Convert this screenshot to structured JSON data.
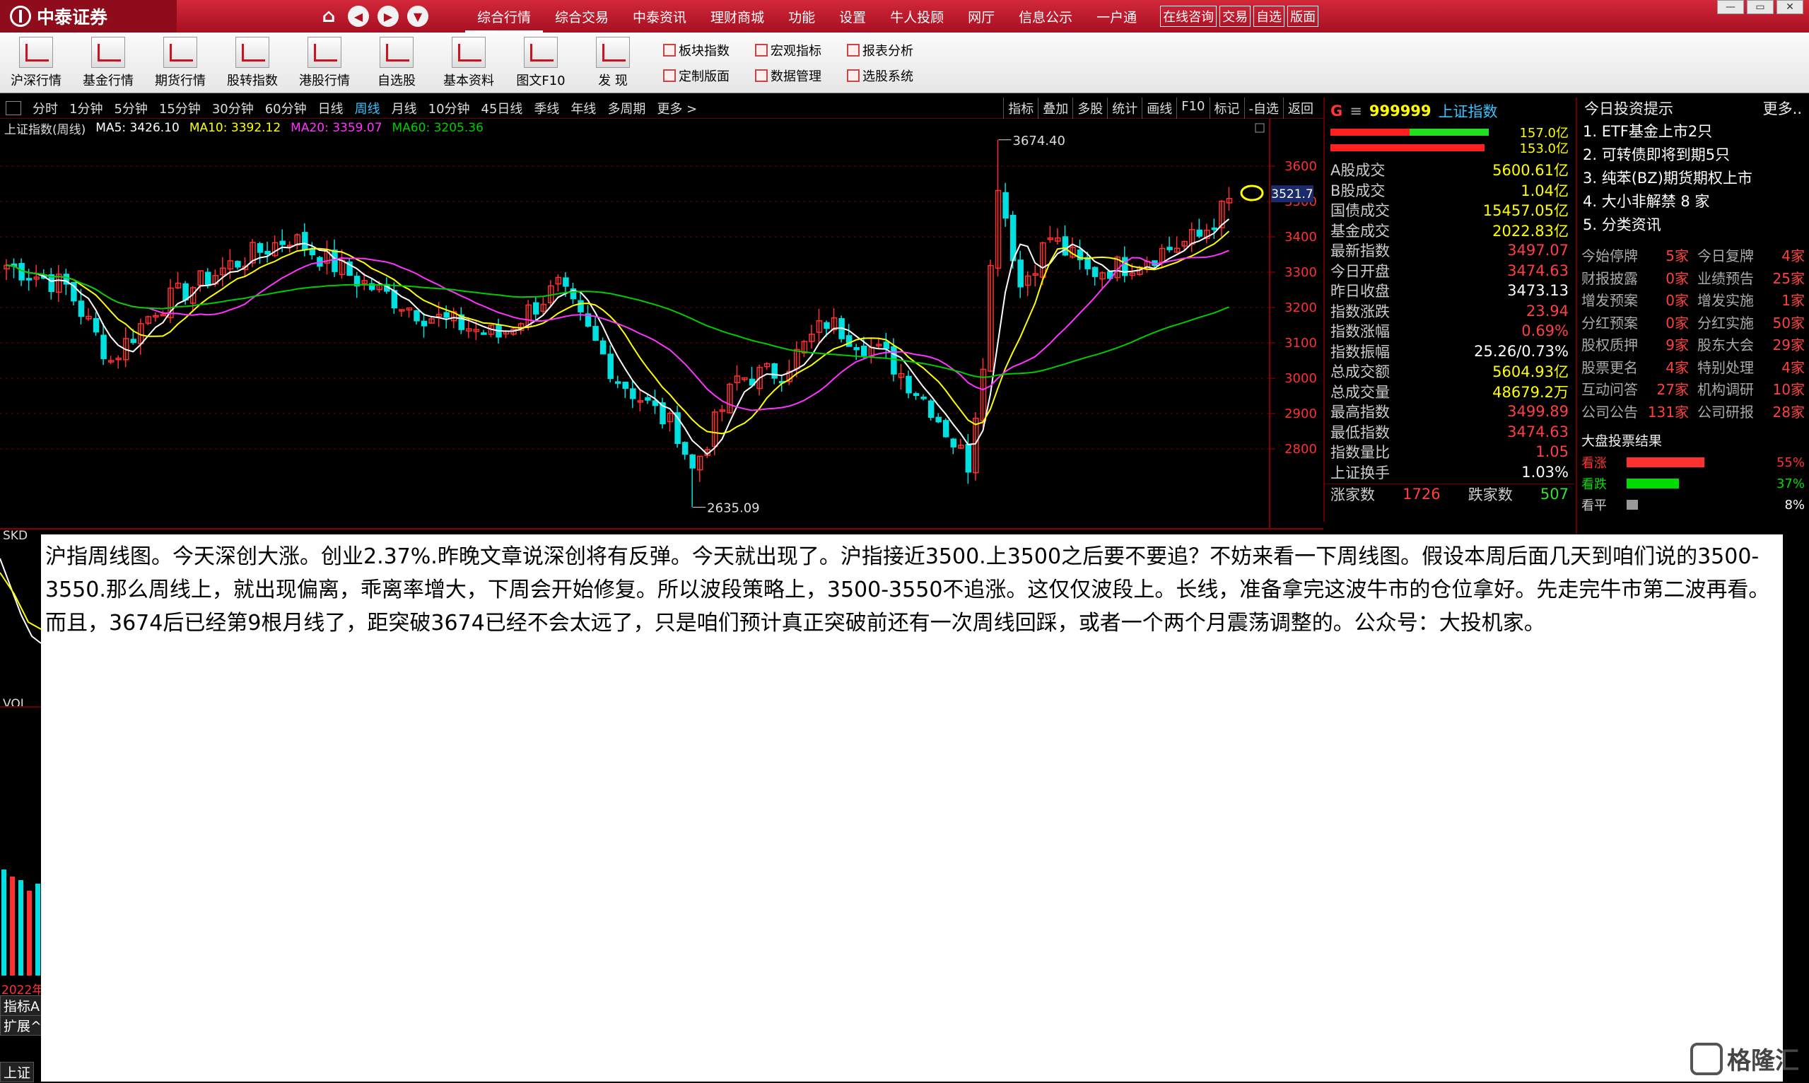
{
  "app": {
    "logo": "中泰证券",
    "menu": [
      "综合行情",
      "综合交易",
      "中泰资讯",
      "理财商城",
      "功能",
      "设置",
      "牛人投顾",
      "网厅",
      "信息公示",
      "一户通"
    ],
    "title_buttons": [
      "在线咨询",
      "交易",
      "自选",
      "版面"
    ]
  },
  "toolbar": {
    "tools": [
      "沪深行情",
      "基金行情",
      "期货行情",
      "股转指数",
      "港股行情",
      "自选股",
      "基本资料",
      "图文F10",
      "发  现"
    ],
    "small_tools": [
      "板块指数",
      "宏观指标",
      "报表分析",
      "定制版面",
      "数据管理",
      "选股系统"
    ]
  },
  "periods": [
    "分时",
    "1分钟",
    "5分钟",
    "15分钟",
    "30分钟",
    "60分钟",
    "日线",
    "周线",
    "月线",
    "10分钟",
    "45日线",
    "季线",
    "年线",
    "多周期",
    "更多 >"
  ],
  "active_period": "周线",
  "chart_tools": [
    "指标",
    "叠加",
    "多股",
    "统计",
    "画线",
    "F10",
    "标记",
    "-自选",
    "返回"
  ],
  "chart": {
    "name": "上证指数(周线)",
    "ma": [
      {
        "label": "MA5: 3426.10",
        "color": "#ffffff"
      },
      {
        "label": "MA10: 3392.12",
        "color": "#ffff00"
      },
      {
        "label": "MA20: 3359.07",
        "color": "#ff33ff"
      },
      {
        "label": "MA60: 3205.36",
        "color": "#00cc00"
      }
    ],
    "y_ticks": [
      "3600",
      "3500",
      "3400",
      "3300",
      "3200",
      "3100",
      "3000",
      "2900",
      "2800"
    ],
    "current_price": "3521.7",
    "high_label": "3674.40",
    "low_label": "2635.09"
  },
  "chart_data": {
    "type": "candlestick",
    "title": "上证指数(周线)",
    "ylim": [
      2620,
      3700
    ],
    "high": 3674.4,
    "low": 2635.09,
    "last": 3521.7
  },
  "info": {
    "g": "G",
    "eq": "≡",
    "code": "999999",
    "name": "上证指数",
    "bar_top": "157.0亿",
    "bar_bot": "153.0亿",
    "rows": [
      {
        "label": "A股成交",
        "value": "5600.61亿",
        "cls": "v-yel"
      },
      {
        "label": "B股成交",
        "value": "1.04亿",
        "cls": "v-yel"
      },
      {
        "label": "国债成交",
        "value": "15457.05亿",
        "cls": "v-yel"
      },
      {
        "label": "基金成交",
        "value": "2022.83亿",
        "cls": "v-yel"
      },
      {
        "label": "最新指数",
        "value": "3497.07",
        "cls": "v-red"
      },
      {
        "label": "今日开盘",
        "value": "3474.63",
        "cls": "v-red"
      },
      {
        "label": "昨日收盘",
        "value": "3473.13",
        "cls": "v-wht"
      },
      {
        "label": "指数涨跌",
        "value": "23.94",
        "cls": "v-red"
      },
      {
        "label": "指数涨幅",
        "value": "0.69%",
        "cls": "v-red"
      },
      {
        "label": "指数振幅",
        "value": "25.26/0.73%",
        "cls": "v-wht"
      },
      {
        "label": "总成交额",
        "value": "5604.93亿",
        "cls": "v-yel"
      },
      {
        "label": "总成交量",
        "value": "48679.2万",
        "cls": "v-yel"
      },
      {
        "label": "最高指数",
        "value": "3499.89",
        "cls": "v-red"
      },
      {
        "label": "最低指数",
        "value": "3474.63",
        "cls": "v-red"
      },
      {
        "label": "指数量比",
        "value": "1.05",
        "cls": "v-red"
      },
      {
        "label": "上证换手",
        "value": "1.03%",
        "cls": "v-wht"
      }
    ],
    "rise_label": "涨家数",
    "rise_value": "1726",
    "fall_label": "跌家数",
    "fall_value": "507"
  },
  "news": {
    "title": "今日投资提示",
    "more": "更多..",
    "items": [
      "1. ETF基金上市2只",
      "2. 可转债即将到期5只",
      "3. 纯苯(BZ)期货期权上市",
      "4. 大小非解禁 8 家",
      "5. 分类资讯"
    ],
    "stats": [
      [
        "今始停牌",
        "5家",
        "今日复牌",
        "4家"
      ],
      [
        "财报披露",
        "0家",
        "业绩预告",
        "25家"
      ],
      [
        "增发预案",
        "0家",
        "增发实施",
        "1家"
      ],
      [
        "分红预案",
        "0家",
        "分红实施",
        "50家"
      ],
      [
        "股权质押",
        "9家",
        "股东大会",
        "29家"
      ],
      [
        "股票更名",
        "4家",
        "特别处理",
        "4家"
      ],
      [
        "互动问答",
        "27家",
        "机构调研",
        "10家"
      ],
      [
        "公司公告",
        "131家",
        "公司研报",
        "28家"
      ]
    ],
    "vote_title": "大盘投票结果",
    "votes": [
      {
        "label": "看涨",
        "pct": "55%",
        "color": "#ff3030",
        "frac": 0.55
      },
      {
        "label": "看跌",
        "pct": "37%",
        "color": "#00dd00",
        "frac": 0.37
      },
      {
        "label": "看平",
        "pct": "8%",
        "color": "#999999",
        "frac": 0.08
      }
    ]
  },
  "sub": {
    "skd": "SKD",
    "vol": "VOL",
    "year": "2022年",
    "tab1": "指标A",
    "tab2": "扩展^",
    "tab3": "上证"
  },
  "overlay_text": "沪指周线图。今天深创大涨。创业2.37%.昨晚文章说深创将有反弹。今天就出现了。沪指接近3500.上3500之后要不要追？不妨来看一下周线图。假设本周后面几天到咱们说的3500-3550.那么周线上，就出现偏离，乖离率增大，下周会开始修复。所以波段策略上，3500-3550不追涨。这仅仅波段上。长线，准备拿完这波牛市的仓位拿好。先走完牛市第二波再看。而且，3674后已经第9根月线了，距突破3674已经不会太远了，只是咱们预计真正突破前还有一次周线回踩，或者一个两个月震荡调整的。公众号：大投机家。",
  "watermark": "格隆汇"
}
